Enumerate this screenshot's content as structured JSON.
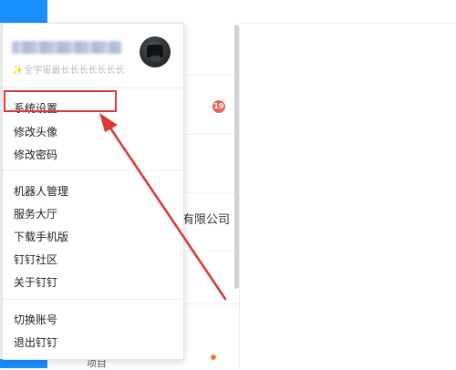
{
  "background": {
    "badge_count": "19",
    "company_text": "有限公司",
    "bottom_label": "项目"
  },
  "profile": {
    "username": "■■■ ■■■■■■■",
    "signature_icon": "✨",
    "signature": "全宇宙最长长长长长长长"
  },
  "menu": {
    "group1": [
      "系统设置",
      "修改头像",
      "修改密码"
    ],
    "group2": [
      "机器人管理",
      "服务大厅",
      "下载手机版",
      "钉钉社区",
      "关于钉钉"
    ],
    "group3": [
      "切换账号",
      "退出钉钉"
    ]
  },
  "annotation": {
    "highlight_color": "#d93b3b",
    "arrow_color": "#d93b3b"
  },
  "colors": {
    "accent": "#1890ff",
    "badge": "#e4655a"
  }
}
